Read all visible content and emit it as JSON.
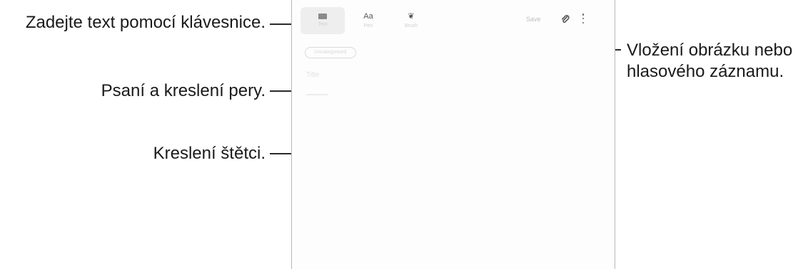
{
  "callouts": {
    "keyboard": "Zadejte text pomocí klávesnice.",
    "pen": "Psaní a kreslení pery.",
    "brush": "Kreslení štětci.",
    "attach_line1": "Vložení obrázku nebo",
    "attach_line2": "hlasového záznamu."
  },
  "toolbar": {
    "tools": [
      {
        "name": "keyboard",
        "icon": "keyboard-icon",
        "label": "Text"
      },
      {
        "name": "pen",
        "icon": "text-aa-icon",
        "label": "Pen"
      },
      {
        "name": "brush",
        "icon": "brush-icon",
        "label": "Brush"
      }
    ],
    "pen_glyph": "Aa",
    "brush_glyph": "❦",
    "save_label": "Save"
  },
  "note": {
    "category_label": "Uncategorised",
    "title_placeholder": "Title"
  },
  "colors": {
    "callout_line": "#2a2a2a",
    "screen_border": "#b9b9b9",
    "active_tool_bg": "#eeeeee"
  }
}
